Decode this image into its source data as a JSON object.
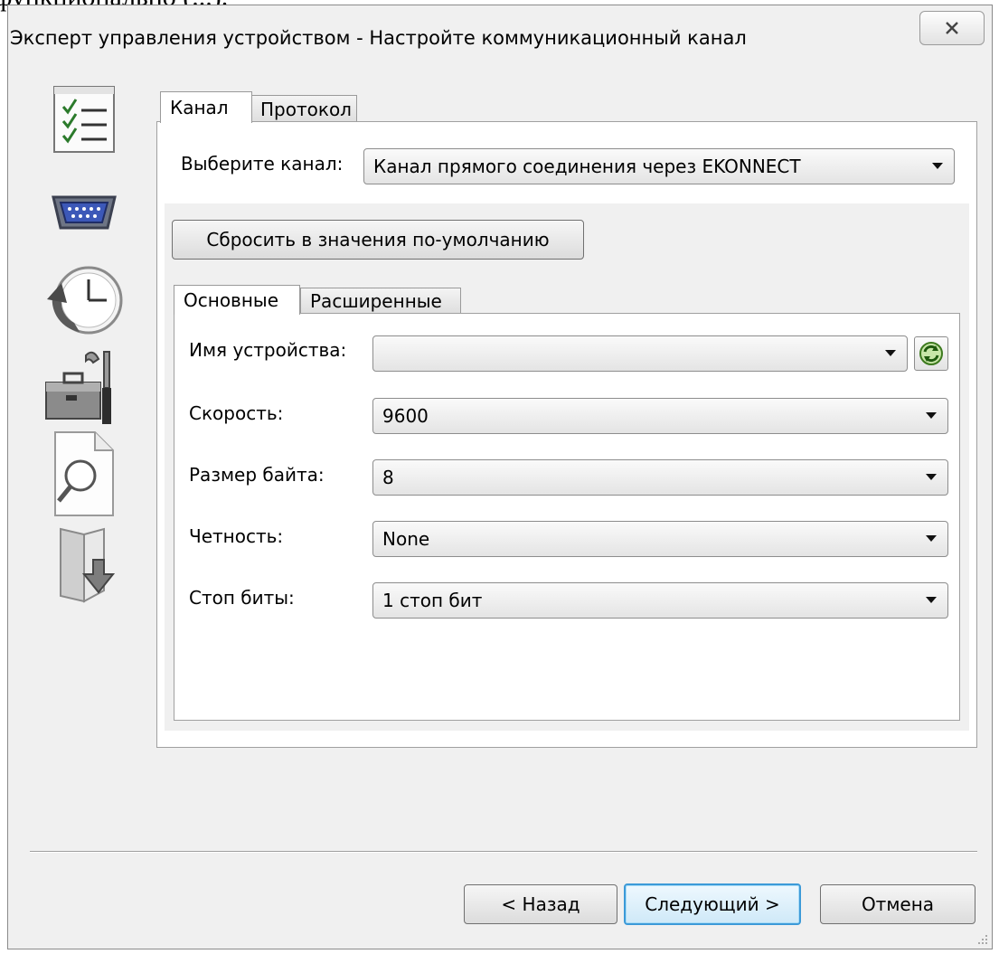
{
  "above_text": "функционально (...).",
  "window": {
    "title": "Эксперт управления устройством - Настройте коммуникационный канал",
    "close_icon": "close-icon"
  },
  "sidebar": {
    "icons": [
      "checklist-icon",
      "serial-port-icon",
      "clock-history-icon",
      "toolbox-icon",
      "document-search-icon",
      "folder-download-icon"
    ]
  },
  "outer_tabs": {
    "items": [
      {
        "label": "Канал",
        "active": true
      },
      {
        "label": "Протокол",
        "active": false
      }
    ]
  },
  "channel": {
    "label": "Выберите канал:",
    "value": "Канал прямого соединения через EKONNECT"
  },
  "reset_button": "Сбросить в значения по-умолчанию",
  "inner_tabs": {
    "items": [
      {
        "label": "Основные",
        "active": true
      },
      {
        "label": "Расширенные",
        "active": false
      }
    ]
  },
  "fields": [
    {
      "label": "Имя устройства:",
      "value": ""
    },
    {
      "label": "Скорость:",
      "value": "9600"
    },
    {
      "label": "Размер байта:",
      "value": "8"
    },
    {
      "label": "Четность:",
      "value": "None"
    },
    {
      "label": "Стоп биты:",
      "value": "1 стоп бит"
    }
  ],
  "refresh_icon": "refresh-icon",
  "footer": {
    "back": "< Назад",
    "next": "Следующий >",
    "cancel": "Отмена"
  }
}
